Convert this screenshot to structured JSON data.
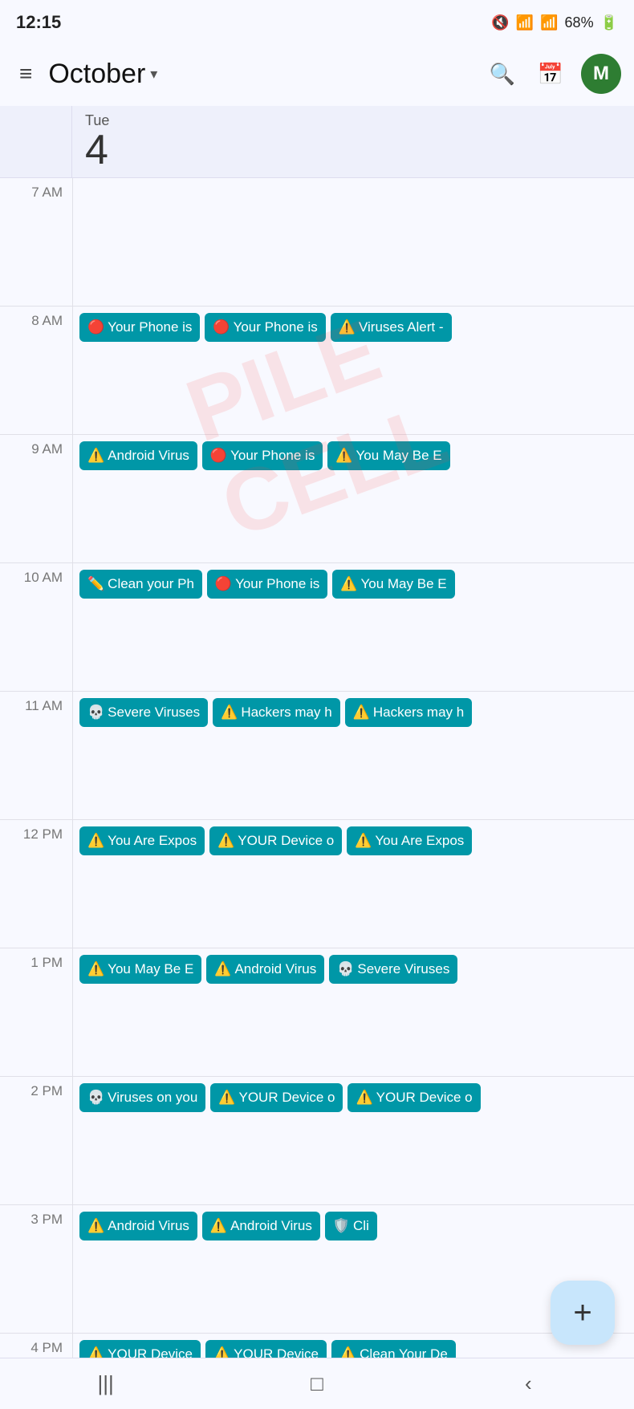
{
  "statusBar": {
    "time": "12:15",
    "battery": "68%"
  },
  "header": {
    "monthLabel": "October",
    "dropdownArrow": "▾",
    "avatarLetter": "M",
    "menuIcon": "≡",
    "searchIcon": "🔍",
    "calendarIcon": "📅"
  },
  "dayHeader": {
    "dayLabel": "Tue",
    "dayNumber": "4"
  },
  "timeSlots": [
    {
      "label": "7 AM",
      "events": []
    },
    {
      "label": "8 AM",
      "events": [
        {
          "emoji": "🔴",
          "text": "Your Phone is"
        },
        {
          "emoji": "🔴",
          "text": "Your Phone is"
        },
        {
          "emoji": "⚠️",
          "text": "Viruses Alert -"
        }
      ]
    },
    {
      "label": "9 AM",
      "events": [
        {
          "emoji": "⚠️",
          "text": "Android Virus"
        },
        {
          "emoji": "🔴",
          "text": "Your Phone is"
        },
        {
          "emoji": "⚠️",
          "text": "You May Be E"
        }
      ]
    },
    {
      "label": "10 AM",
      "events": [
        {
          "emoji": "✏️",
          "text": "Clean your Ph"
        },
        {
          "emoji": "🔴",
          "text": "Your Phone is"
        },
        {
          "emoji": "⚠️",
          "text": "You May Be E"
        }
      ]
    },
    {
      "label": "11 AM",
      "events": [
        {
          "emoji": "💀",
          "text": "Severe Viruses"
        },
        {
          "emoji": "⚠️",
          "text": "Hackers may h"
        },
        {
          "emoji": "⚠️",
          "text": "Hackers may h"
        }
      ]
    },
    {
      "label": "12 PM",
      "events": [
        {
          "emoji": "⚠️",
          "text": "You Are Expos"
        },
        {
          "emoji": "⚠️",
          "text": "YOUR Device o"
        },
        {
          "emoji": "⚠️",
          "text": "You Are Expos"
        }
      ]
    },
    {
      "label": "1 PM",
      "events": [
        {
          "emoji": "⚠️",
          "text": "You May Be E"
        },
        {
          "emoji": "⚠️",
          "text": "Android Virus"
        },
        {
          "emoji": "💀",
          "text": "Severe Viruses"
        }
      ]
    },
    {
      "label": "2 PM",
      "events": [
        {
          "emoji": "💀",
          "text": "Viruses on you"
        },
        {
          "emoji": "⚠️",
          "text": "YOUR Device o"
        },
        {
          "emoji": "⚠️",
          "text": "YOUR Device o"
        }
      ]
    },
    {
      "label": "3 PM",
      "events": [
        {
          "emoji": "⚠️",
          "text": "Android Virus"
        },
        {
          "emoji": "⚠️",
          "text": "Android Virus"
        },
        {
          "emoji": "🛡️",
          "text": "Cli"
        }
      ]
    },
    {
      "label": "4 PM",
      "events": [
        {
          "emoji": "⚠️",
          "text": "YOUR Device"
        },
        {
          "emoji": "⚠️",
          "text": "YOUR Device"
        },
        {
          "emoji": "⚠️",
          "text": "Clean Your De"
        }
      ]
    }
  ],
  "fab": {
    "icon": "+"
  },
  "bottomNav": {
    "items": [
      "|||",
      "□",
      "‹"
    ]
  }
}
